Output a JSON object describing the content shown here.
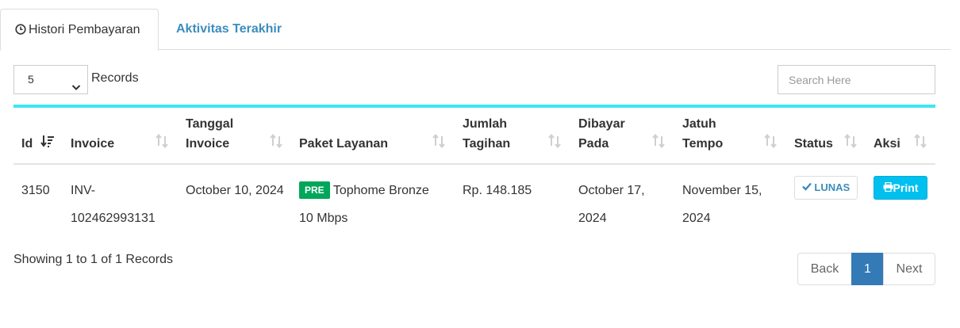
{
  "tabs": [
    {
      "label": "Histori Pembayaran",
      "icon": "clock-icon",
      "active": true
    },
    {
      "label": "Aktivitas Terakhir",
      "active": false
    }
  ],
  "controls": {
    "page_size": "5",
    "records_label": "Records",
    "search_placeholder": "Search Here"
  },
  "table": {
    "columns": {
      "id": "Id",
      "invoice": "Invoice",
      "tanggal_1": "Tanggal",
      "tanggal_2": "Invoice",
      "paket": "Paket Layanan",
      "jumlah_1": "Jumlah",
      "jumlah_2": "Tagihan",
      "dibayar_1": "Dibayar",
      "dibayar_2": "Pada",
      "jatuh_1": "Jatuh",
      "jatuh_2": "Tempo",
      "status": "Status",
      "aksi": "Aksi"
    },
    "rows": [
      {
        "id": "3150",
        "invoice_1": "INV-",
        "invoice_2": "102462993131",
        "tanggal": "October 10, 2024",
        "paket_badge": "PRE",
        "paket_1": "Tophome Bronze",
        "paket_2": "10 Mbps",
        "jumlah": "Rp. 148.185",
        "dibayar_1": "October 17,",
        "dibayar_2": "2024",
        "jatuh_1": "November 15,",
        "jatuh_2": "2024",
        "status": "LUNAS",
        "aksi": "Print"
      }
    ]
  },
  "footer": {
    "showing": "Showing 1 to 1 of 1 Records",
    "pagination": {
      "back": "Back",
      "current": "1",
      "next": "Next"
    }
  },
  "colors": {
    "accent_line": "#3ee6f0",
    "link": "#3c8dbc",
    "badge_green": "#00a65a",
    "print_button": "#00c0ef",
    "active_page": "#337ab7"
  }
}
